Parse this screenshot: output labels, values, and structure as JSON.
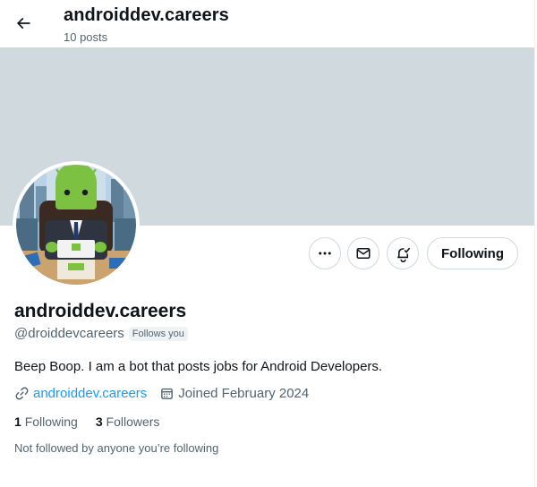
{
  "header": {
    "title": "androiddev.careers",
    "post_count": "10 posts"
  },
  "profile": {
    "display_name": "androiddev.careers",
    "handle": "@droiddevcareers",
    "follows_you_badge": "Follows you",
    "bio": "Beep Boop. I am a bot that posts jobs for Android Developers.",
    "website": "androiddev.careers",
    "joined": "Joined February 2024"
  },
  "actions": {
    "more_icon": "more-icon",
    "message_icon": "mail-icon",
    "notify_icon": "bell-check-icon",
    "following_label": "Following"
  },
  "stats": {
    "following_count": "1",
    "following_label": "Following",
    "followers_count": "3",
    "followers_label": "Followers"
  },
  "followed_by_note": "Not followed by anyone you’re following",
  "colors": {
    "banner": "#cfd9de",
    "link": "#1d9bf0",
    "secondary_text": "#536471",
    "primary_text": "#0f1419"
  }
}
